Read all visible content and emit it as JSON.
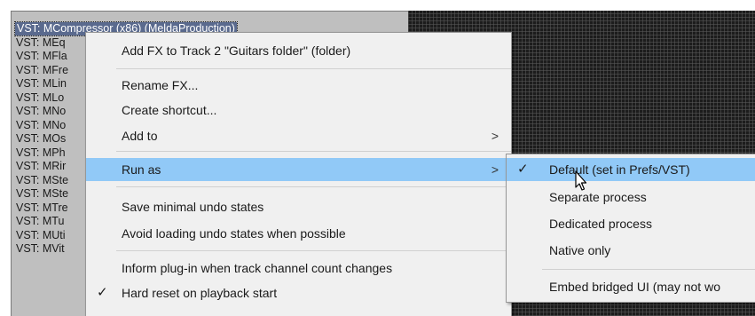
{
  "fx_list": {
    "items": [
      "VST: MCompressor (x86) (MeldaProduction)",
      "VST: MEq",
      "VST: MFla",
      "VST: MFre",
      "VST: MLin",
      "VST: MLo",
      "VST: MNo",
      "VST: MNo",
      "VST: MOs",
      "VST: MPh",
      "VST: MRir",
      "VST: MSte",
      "VST: MSte",
      "VST: MTre",
      "VST: MTu",
      "VST: MUti",
      "VST: MVit"
    ]
  },
  "context_menu": {
    "add_fx": "Add FX to Track 2 \"Guitars folder\" (folder)",
    "rename": "Rename FX...",
    "create_shortcut": "Create shortcut...",
    "add_to": "Add to",
    "run_as": "Run as",
    "save_minimal_undo": "Save minimal undo states",
    "avoid_loading_undo": "Avoid loading undo states when possible",
    "inform_plugin": "Inform plug-in when track channel count changes",
    "hard_reset": "Hard reset on playback start",
    "submenu_arrow": ">",
    "check_mark": "✓"
  },
  "run_as_submenu": {
    "default": "Default (set in Prefs/VST)",
    "separate": "Separate process",
    "dedicated": "Dedicated process",
    "native": "Native only",
    "embed": "Embed bridged UI (may not wo"
  },
  "colors": {
    "highlight": "#91c9f7",
    "selection": "#5a6a8e"
  }
}
